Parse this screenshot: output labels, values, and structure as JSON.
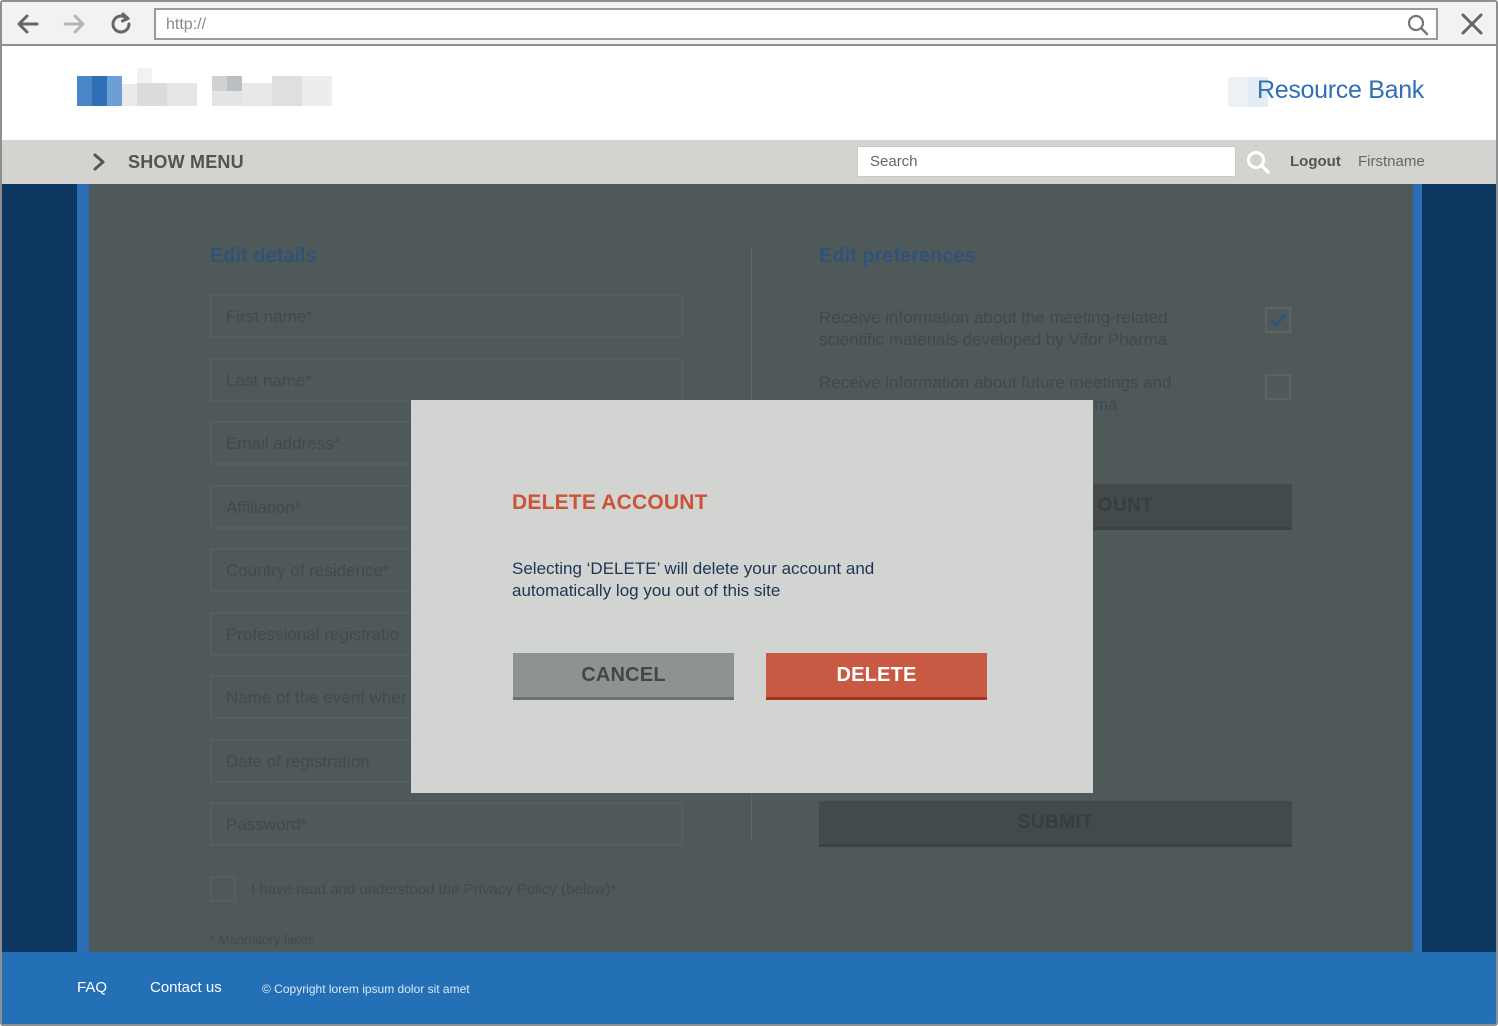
{
  "browser": {
    "url": "http://"
  },
  "header": {
    "brand": "Resource Bank"
  },
  "menubar": {
    "show_menu": "SHOW MENU",
    "search_placeholder": "Search",
    "logout": "Logout",
    "username": "Firstname"
  },
  "edit_details": {
    "title": "Edit details",
    "fields": [
      "First name*",
      "Last name*",
      "Email address*",
      "Affiliation*",
      "Country of residence*",
      "Professional registratio",
      "Name of the event wher",
      "Date of registration",
      "Password*"
    ],
    "privacy": "I have read and understood the Privacy Policy (below)*",
    "mandatory": "* Mandatory fields"
  },
  "edit_preferences": {
    "title": "Edit preferences",
    "options": [
      {
        "label": "Receive information about the meeting-related scientific materials developed by Vifor Pharma",
        "checked": true
      },
      {
        "label": "Receive information about future meetings and",
        "checked": false
      }
    ],
    "option2_trailing": "ma",
    "delete_partial": "OUNT",
    "submit": "SUBMIT"
  },
  "modal": {
    "title": "DELETE ACCOUNT",
    "body": "Selecting ‘DELETE’ will delete your account and automatically log you out of this site",
    "cancel": "CANCEL",
    "delete": "DELETE"
  },
  "footer": {
    "faq": "FAQ",
    "contact": "Contact us",
    "copyright": "© Copyright lorem ipsum dolor sit amet"
  },
  "colors": {
    "brand_blue": "#2470b6",
    "navy": "#0d3761",
    "danger": "#cc5238"
  }
}
